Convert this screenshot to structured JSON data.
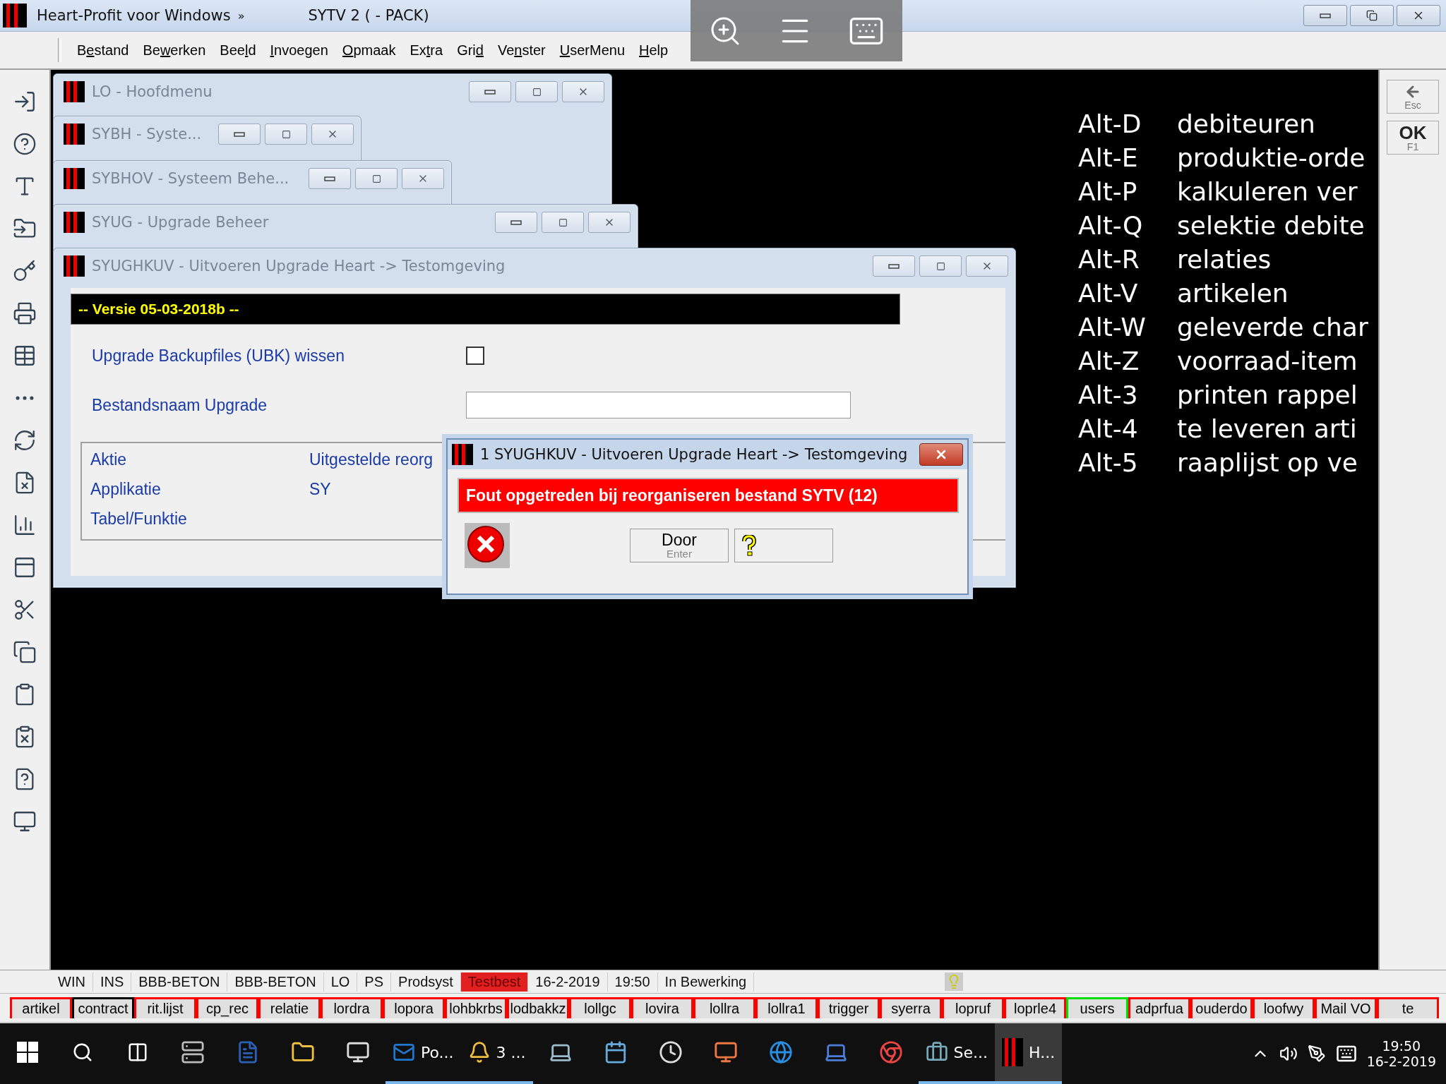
{
  "app": {
    "title": "Heart-Profit voor Windows",
    "chevron": "»",
    "document": "SYTV 2  ( - PACK)"
  },
  "menu": [
    {
      "before": "B",
      "key": "e",
      "after": "stand"
    },
    {
      "before": "Be",
      "key": "w",
      "after": "erken"
    },
    {
      "before": "Bee",
      "key": "l",
      "after": "d"
    },
    {
      "key": "I",
      "after": "nvoegen"
    },
    {
      "key": "O",
      "after": "pmaak"
    },
    {
      "before": "Ex",
      "key": "t",
      "after": "ra"
    },
    {
      "before": "Gri",
      "key": "d"
    },
    {
      "before": "Ve",
      "key": "n",
      "after": "ster"
    },
    {
      "key": "U",
      "after": "serMenu"
    },
    {
      "key": "H",
      "after": "elp"
    }
  ],
  "windows": [
    {
      "title": "LO - Hoofdmenu"
    },
    {
      "title": "SYBH - Syste..."
    },
    {
      "title": "SYBHOV - Systeem Behe..."
    },
    {
      "title": "SYUG - Upgrade Beheer"
    },
    {
      "title": "SYUGHKUV - Uitvoeren Upgrade Heart -> Testomgeving"
    }
  ],
  "form": {
    "banner": "-- Versie 05-03-2018b --",
    "fields": [
      {
        "kind": "checkbox",
        "label": "Upgrade Backupfiles (UBK) wissen",
        "checked": false
      },
      {
        "kind": "text",
        "label": "Bestandsnaam Upgrade"
      }
    ],
    "info": [
      {
        "label": "Aktie",
        "value": "Uitgestelde reorg"
      },
      {
        "label": "Applikatie",
        "value": "SY"
      },
      {
        "label": "Tabel/Funktie"
      }
    ]
  },
  "dialog": {
    "title": "1 SYUGHKUV - Uitvoeren Upgrade Heart -> Testomgeving",
    "message": "Fout opgetreden bij reorganiseren bestand SYTV (12)",
    "button": {
      "label": "Door",
      "hint": "Enter"
    }
  },
  "shortcuts": [
    {
      "key": "Alt-D",
      "label": "debiteuren"
    },
    {
      "key": "Alt-E",
      "label": "produktie-orde"
    },
    {
      "key": "Alt-P",
      "label": "kalkuleren ver"
    },
    {
      "key": "Alt-Q",
      "label": "selektie debite"
    },
    {
      "key": "Alt-R",
      "label": "relaties"
    },
    {
      "key": "Alt-V",
      "label": "artikelen"
    },
    {
      "key": "Alt-W",
      "label": "geleverde char"
    },
    {
      "key": "Alt-Z",
      "label": "voorraad-item"
    },
    {
      "key": "Alt-3",
      "label": "printen rappel"
    },
    {
      "key": "Alt-4",
      "label": "te leveren arti"
    },
    {
      "key": "Alt-5",
      "label": "raaplijst op ve"
    }
  ],
  "side_buttons": [
    {
      "label": "Esc"
    },
    {
      "label": "OK",
      "hint": "F1"
    }
  ],
  "status": [
    {
      "text": "WIN",
      "highlighted": false
    },
    {
      "text": "INS",
      "highlighted": false
    },
    {
      "text": "BBB-BETON",
      "highlighted": false
    },
    {
      "text": "BBB-BETON",
      "highlighted": false
    },
    {
      "text": "LO",
      "highlighted": false
    },
    {
      "text": "PS",
      "highlighted": false
    },
    {
      "text": "Prodsyst",
      "highlighted": false
    },
    {
      "text": "Testbest",
      "highlighted": true
    },
    {
      "text": "16-2-2019",
      "highlighted": false
    },
    {
      "text": "19:50",
      "highlighted": false
    },
    {
      "text": "In Bewerking",
      "highlighted": false
    }
  ],
  "tabs": [
    {
      "label": "artikel",
      "color": "#ff0000"
    },
    {
      "label": "contract",
      "color": "#000000"
    },
    {
      "label": "rit.lijst",
      "color": "#ff0000"
    },
    {
      "label": "cp_rec",
      "color": "#ff0000"
    },
    {
      "label": "relatie",
      "color": "#ff0000"
    },
    {
      "label": "lordra",
      "color": "#ff0000"
    },
    {
      "label": "lopora",
      "color": "#ff0000"
    },
    {
      "label": "lohbkrbs",
      "color": "#ff0000"
    },
    {
      "label": "lodbakkz",
      "color": "#ff0000"
    },
    {
      "label": "lollgc",
      "color": "#ff0000"
    },
    {
      "label": "lovira",
      "color": "#ff0000"
    },
    {
      "label": "lollra",
      "color": "#ff0000"
    },
    {
      "label": "lollra1",
      "color": "#ff0000"
    },
    {
      "label": "trigger",
      "color": "#ff0000"
    },
    {
      "label": "syerra",
      "color": "#ff0000"
    },
    {
      "label": "lopruf",
      "color": "#ff0000"
    },
    {
      "label": "loprle4",
      "color": "#ff0000"
    },
    {
      "label": "users",
      "color": "#00e000"
    },
    {
      "label": "adprfua",
      "color": "#ff0000"
    },
    {
      "label": "ouderdo",
      "color": "#ff0000"
    },
    {
      "label": "loofwy",
      "color": "#ff0000"
    },
    {
      "label": "Mail VO",
      "color": "#ff0000"
    },
    {
      "label": "te",
      "color": "#ff0000"
    }
  ],
  "taskbar": {
    "apps": [
      {
        "label": "Po...",
        "active": false
      },
      {
        "label": "3 ...",
        "active": false
      },
      {
        "label": "Se...",
        "active": false
      },
      {
        "label": "H...",
        "active": true
      }
    ],
    "time": "19:50",
    "date": "16-2-2019"
  }
}
